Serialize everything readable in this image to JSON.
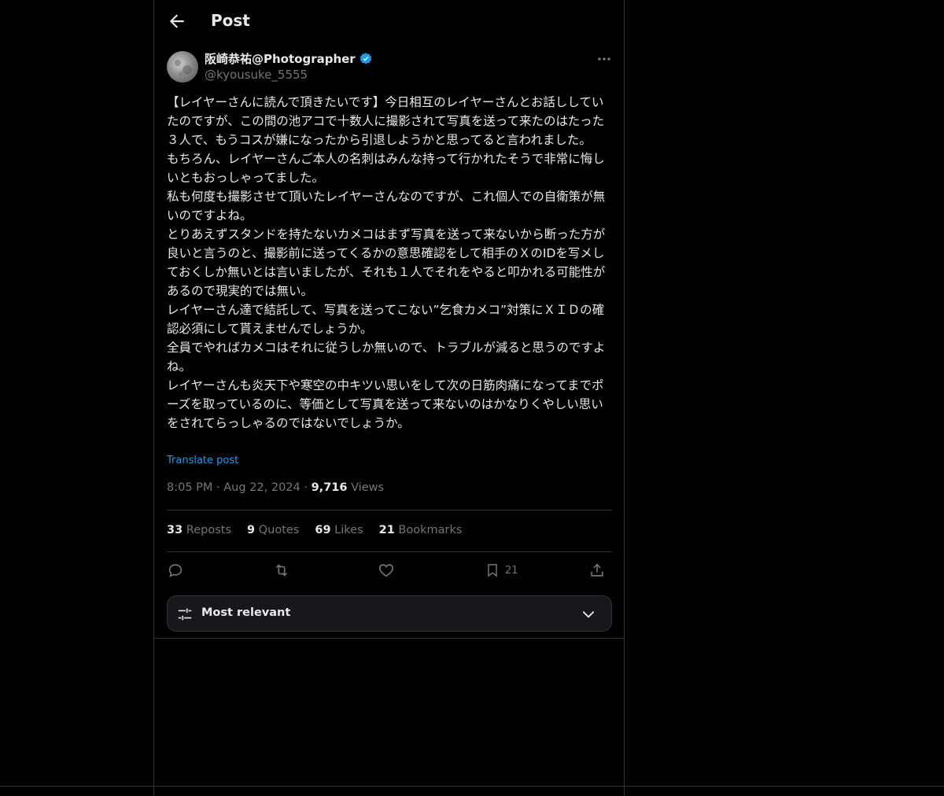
{
  "header": {
    "title": "Post",
    "back_icon": "back-arrow-icon"
  },
  "post": {
    "display_name": "阪崎恭祐@Photographer",
    "handle": "@kyousuke_5555",
    "verified": true,
    "text": "【レイヤーさんに読んで頂きたいです】今日相互のレイヤーさんとお話ししていたのですが、この間の池アコで十数人に撮影されて写真を送って来たのはたった３人で、もうコスが嫌になったから引退しようかと思ってると言われました。\nもちろん、レイヤーさんご本人の名刺はみんな持って行かれたそうで非常に悔しいともおっしゃってました。\n私も何度も撮影させて頂いたレイヤーさんなのですが、これ個人での自衛策が無いのですよね。\nとりあえずスタンドを持たないカメコはまず写真を送って来ないから断った方が良いと言うのと、撮影前に送ってくるかの意思確認をして相手のＸのIDを写メしておくしか無いとは言いましたが、それも１人でそれをやると叩かれる可能性があるので現実的では無い。\nレイヤーさん達で結託して、写真を送ってこない”乞食カメコ”対策にＸＩＤの確認必須にして貰えませんでしょうか。\n全員でやればカメコはそれに従うしか無いので、トラブルが減ると思うのですよね。\nレイヤーさんも炎天下や寒空の中キツい思いをして次の日筋肉痛になってまでポーズを取っているのに、等価として写真を送って来ないのはかなりくやしい思いをされてらっしゃるのではないでしょうか。",
    "translate_label": "Translate post",
    "time": "8:05 PM",
    "date": "Aug 22, 2024",
    "views_count": "9,716",
    "views_label": "Views"
  },
  "stats": {
    "reposts_count": "33",
    "reposts_label": "Reposts",
    "quotes_count": "9",
    "quotes_label": "Quotes",
    "likes_count": "69",
    "likes_label": "Likes",
    "bookmarks_count": "21",
    "bookmarks_label": "Bookmarks"
  },
  "actions": {
    "bookmark_count": "21"
  },
  "sort": {
    "label": "Most relevant"
  },
  "colors": {
    "background": "#000000",
    "text": "#e7e9ea",
    "muted": "#71767b",
    "accent": "#1d9bf0",
    "border": "#2f3336"
  }
}
